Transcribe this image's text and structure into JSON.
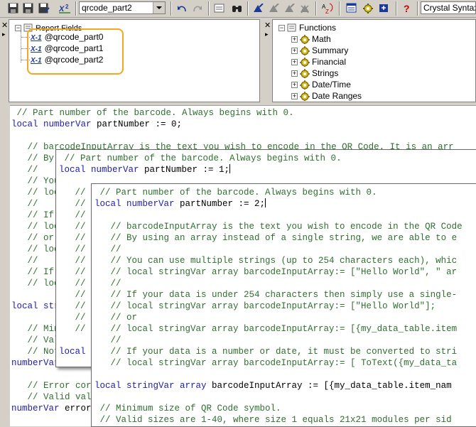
{
  "toolbar": {
    "formula_name": "qrcode_part2",
    "syntax": "Crystal Syntax",
    "icons": [
      "save-icon",
      "save-close-icon",
      "save-as-icon",
      "x2-icon",
      "undo-icon",
      "redo-icon",
      "browse-data-icon",
      "find-icon",
      "bookmark-icon",
      "next-bookmark-icon",
      "prev-bookmark-icon",
      "clear-bookmarks-icon",
      "sort-az-icon",
      "show-fields-icon",
      "show-functions-icon",
      "show-operators-icon",
      "help-icon"
    ]
  },
  "report_fields": {
    "title": "Report Fields",
    "items": [
      "@qrcode_part0",
      "@qrcode_part1",
      "@qrcode_part2"
    ]
  },
  "functions": {
    "title": "Functions",
    "items": [
      "Math",
      "Summary",
      "Financial",
      "Strings",
      "Date/Time",
      "Date Ranges"
    ]
  },
  "editor1": {
    "lines": [
      [
        [
          "c",
          " // Part number of the barcode. Always begins with 0."
        ]
      ],
      [
        [
          "k",
          "local numberVar"
        ],
        [
          "n",
          " partNumber := 0;"
        ]
      ],
      [
        [
          "n",
          ""
        ]
      ],
      [
        [
          "c",
          "   // barcodeInputArray is the text you wish to encode in the QR Code. It is an arr"
        ]
      ],
      [
        [
          "c",
          "   // By"
        ]
      ],
      [
        [
          "c",
          "   //"
        ]
      ],
      [
        [
          "c",
          "   // You"
        ]
      ],
      [
        [
          "c",
          "   // loc"
        ]
      ],
      [
        [
          "c",
          "   //"
        ]
      ],
      [
        [
          "c",
          "   // If"
        ]
      ],
      [
        [
          "c",
          "   // loc"
        ]
      ],
      [
        [
          "c",
          "   // or"
        ]
      ],
      [
        [
          "c",
          "   // loc"
        ]
      ],
      [
        [
          "c",
          "   //"
        ]
      ],
      [
        [
          "c",
          "   // If"
        ]
      ],
      [
        [
          "c",
          "   // loc"
        ]
      ],
      [
        [
          "n",
          ""
        ]
      ],
      [
        [
          "k",
          "local str"
        ]
      ],
      [
        [
          "n",
          ""
        ]
      ],
      [
        [
          "c",
          "   // Mini"
        ]
      ],
      [
        [
          "c",
          "   // Vali"
        ]
      ],
      [
        [
          "c",
          "   // Note"
        ]
      ],
      [
        [
          "k",
          "numberVar"
        ]
      ],
      [
        [
          "n",
          ""
        ]
      ],
      [
        [
          "c",
          "   // Error corre"
        ]
      ],
      [
        [
          "c",
          "   // Valid value"
        ]
      ],
      [
        [
          "k",
          "numberVar"
        ],
        [
          "n",
          " error"
        ]
      ]
    ]
  },
  "editor2": {
    "lines": [
      [
        [
          "c",
          " // Part number of the barcode. Always begins with 0."
        ]
      ],
      [
        [
          "k",
          "local numberVar"
        ],
        [
          "n",
          " partNumber := 1;"
        ]
      ],
      [
        [
          "n",
          ""
        ]
      ],
      [
        [
          "c",
          "   //"
        ]
      ],
      [
        [
          "c",
          "   //"
        ]
      ],
      [
        [
          "c",
          "   //"
        ]
      ],
      [
        [
          "c",
          "   //"
        ]
      ],
      [
        [
          "c",
          "   //"
        ]
      ],
      [
        [
          "c",
          "   //"
        ]
      ],
      [
        [
          "c",
          "   //"
        ]
      ],
      [
        [
          "c",
          "   //"
        ]
      ],
      [
        [
          "c",
          "   //"
        ]
      ],
      [
        [
          "c",
          "   //"
        ]
      ],
      [
        [
          "c",
          "   //"
        ]
      ],
      [
        [
          "c",
          "   //"
        ]
      ],
      [
        [
          "c",
          "   //"
        ]
      ],
      [
        [
          "n",
          ""
        ]
      ],
      [
        [
          "k",
          "local"
        ]
      ]
    ]
  },
  "editor3": {
    "lines": [
      [
        [
          "c",
          " // Part number of the barcode. Always begins with 0."
        ]
      ],
      [
        [
          "k",
          "local numberVar"
        ],
        [
          "n",
          " partNumber := 2;"
        ]
      ],
      [
        [
          "n",
          ""
        ]
      ],
      [
        [
          "c",
          "   // barcodeInputArray is the text you wish to encode in the QR Code"
        ]
      ],
      [
        [
          "c",
          "   // By using an array instead of a single string, we are able to e"
        ]
      ],
      [
        [
          "c",
          "   //"
        ]
      ],
      [
        [
          "c",
          "   // You can use multiple strings (up to 254 characters each), whic"
        ]
      ],
      [
        [
          "c",
          "   // local stringVar array barcodeInputArray:= [\"Hello World\", \" ar"
        ]
      ],
      [
        [
          "c",
          "   //"
        ]
      ],
      [
        [
          "c",
          "   // If your data is under 254 characters then simply use a single-"
        ]
      ],
      [
        [
          "c",
          "   // local stringVar array barcodeInputArray:= [\"Hello World\"];"
        ]
      ],
      [
        [
          "c",
          "   // or"
        ]
      ],
      [
        [
          "c",
          "   // local stringVar array barcodeInputArray:= [{my_data_table.item"
        ]
      ],
      [
        [
          "c",
          "   //"
        ]
      ],
      [
        [
          "c",
          "   // If your data is a number or date, it must be converted to stri"
        ]
      ],
      [
        [
          "c",
          "   // local stringVar array barcodeInputArray:= [ ToText({my_data_ta"
        ]
      ],
      [
        [
          "n",
          ""
        ]
      ],
      [
        [
          "k",
          "local stringVar array"
        ],
        [
          "n",
          " barcodeInputArray := [{my_data_table.item_nam"
        ]
      ],
      [
        [
          "n",
          ""
        ]
      ],
      [
        [
          "c",
          " // Minimum size of QR Code symbol."
        ]
      ],
      [
        [
          "c",
          " // Valid sizes are 1-40, where size 1 equals 21x21 modules per sid"
        ]
      ]
    ]
  }
}
